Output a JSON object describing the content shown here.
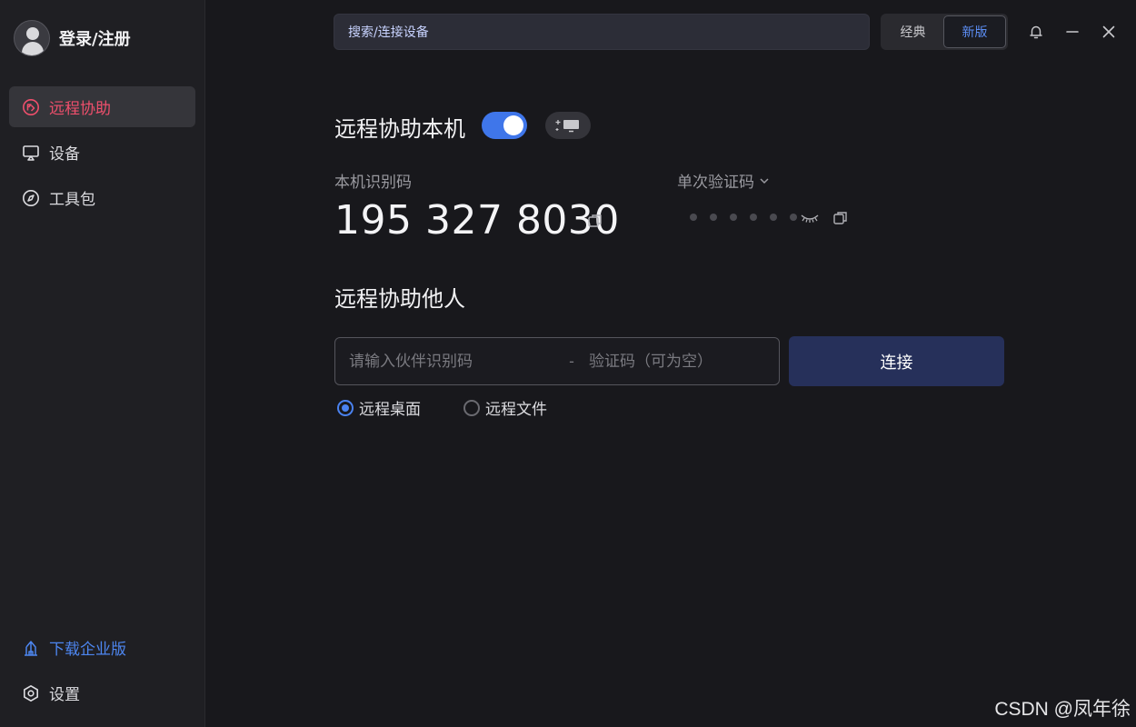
{
  "sidebar": {
    "profile_label": "登录/注册",
    "items": [
      {
        "label": "远程协助",
        "icon": "remote-assist-icon",
        "active": true
      },
      {
        "label": "设备",
        "icon": "monitor-icon"
      },
      {
        "label": "工具包",
        "icon": "compass-icon"
      }
    ],
    "bottom": [
      {
        "label": "下载企业版",
        "icon": "building-icon"
      },
      {
        "label": "设置",
        "icon": "settings-hex-icon"
      }
    ]
  },
  "header": {
    "search_text": "搜索/连接设备",
    "modes": [
      "经典",
      "新版"
    ],
    "active_mode": "新版"
  },
  "this_device": {
    "title": "远程协助本机",
    "enabled": true,
    "id_label": "本机识别码",
    "id_code": "195 327 8030",
    "password_label": "单次验证码",
    "password_masked": "● ● ● ● ● ●"
  },
  "assist_other": {
    "title": "远程协助他人",
    "partner_placeholder": "请输入伙伴识别码",
    "separator": "-",
    "code_placeholder": "验证码（可为空）",
    "connect_label": "连接",
    "options": [
      "远程桌面",
      "远程文件"
    ],
    "selected": "远程桌面"
  },
  "watermark": "CSDN @凤年徐",
  "colors": {
    "accent_blue": "#3f76ea",
    "active_red": "#ef4f6c",
    "connect_bg": "#26305a"
  }
}
